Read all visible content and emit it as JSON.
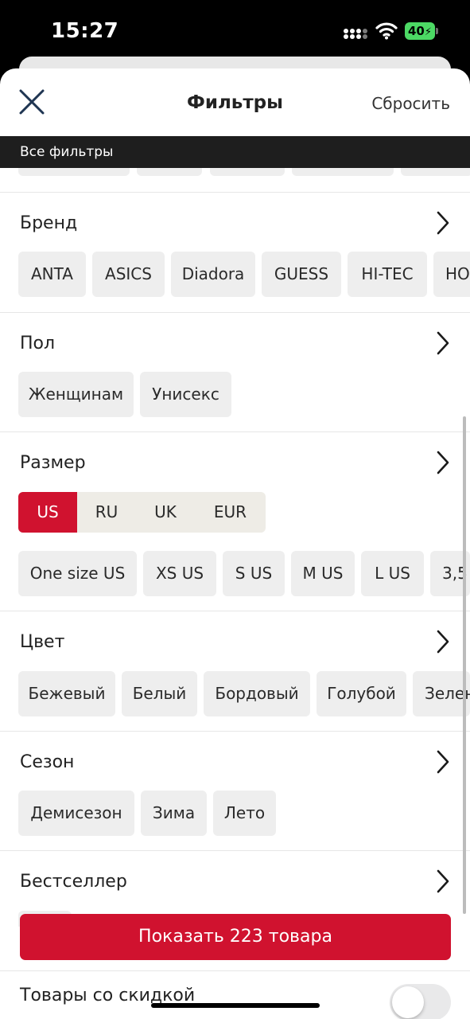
{
  "status_bar": {
    "time": "15:27",
    "battery": "40"
  },
  "header": {
    "title": "Фильтры",
    "reset_label": "Сбросить"
  },
  "all_filters_label": "Все фильтры",
  "sections": {
    "brand": {
      "title": "Бренд",
      "chips": [
        "ANTA",
        "ASICS",
        "Diadora",
        "GUESS",
        "HI-TEC",
        "HO"
      ]
    },
    "gender": {
      "title": "Пол",
      "chips": [
        "Женщинам",
        "Унисекс"
      ]
    },
    "size": {
      "title": "Размер",
      "systems": [
        "US",
        "RU",
        "UK",
        "EUR"
      ],
      "selected_system": "US",
      "chips": [
        "One size US",
        "XS US",
        "S US",
        "M US",
        "L US",
        "3,5"
      ]
    },
    "color": {
      "title": "Цвет",
      "chips": [
        "Бежевый",
        "Белый",
        "Бордовый",
        "Голубой",
        "Зелен"
      ]
    },
    "season": {
      "title": "Сезон",
      "chips": [
        "Демисезон",
        "Зима",
        "Лето"
      ]
    },
    "bestseller": {
      "title": "Бестселлер"
    }
  },
  "show_button_label": "Показать 223 товара",
  "discount": {
    "label": "Товары со скидкой",
    "enabled": false
  },
  "colors": {
    "accent": "#d0122f",
    "chip_bg": "#eeeeee",
    "dark_bar": "#1e1e1e"
  },
  "icons": {
    "close": "close-icon",
    "chevron": "chevron-right-icon",
    "wifi": "wifi-icon",
    "signal": "signal-icon",
    "battery": "battery-icon"
  }
}
